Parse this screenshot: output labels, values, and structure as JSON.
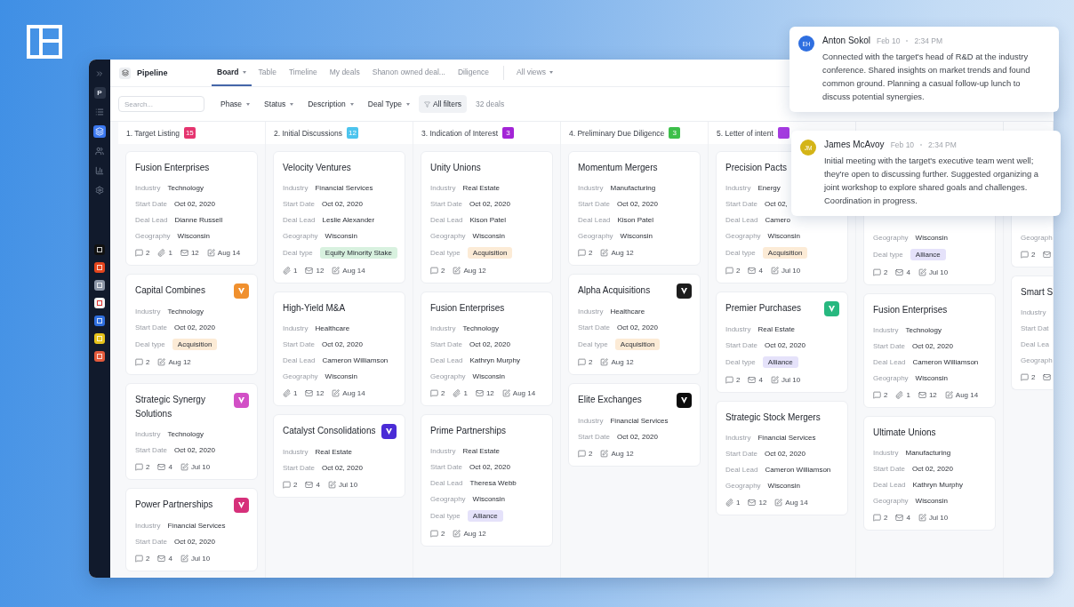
{
  "sidebar": {
    "avatar": "P",
    "nav": [
      {
        "kind": "list",
        "selected": false
      },
      {
        "kind": "layers",
        "selected": true
      },
      {
        "kind": "users",
        "selected": false
      },
      {
        "kind": "chart",
        "selected": false
      },
      {
        "kind": "settings",
        "selected": false
      }
    ],
    "apps": [
      {
        "color": "#111111"
      },
      {
        "color": "#e4451d"
      },
      {
        "color": "#8c96a8"
      },
      {
        "color": "#f4f4f4"
      },
      {
        "color": "#2f6fe0"
      },
      {
        "color": "#e6c21a"
      },
      {
        "color": "#e35a3c"
      }
    ]
  },
  "header": {
    "title": "Pipeline",
    "tabs": [
      {
        "label": "Board",
        "selected": true,
        "caret": true
      },
      {
        "label": "Table",
        "selected": false
      },
      {
        "label": "Timeline",
        "selected": false
      },
      {
        "label": "My deals",
        "selected": false
      },
      {
        "label": "Shanon owned deal...",
        "selected": false
      },
      {
        "label": "Diligence",
        "selected": false
      }
    ],
    "views": "All views"
  },
  "filters": {
    "search": {
      "placeholder": "Search..."
    },
    "dropdowns": [
      "Phase",
      "Status",
      "Description",
      "Deal Type"
    ],
    "all_filters": "All filters",
    "count": "32 deals"
  },
  "columns": [
    {
      "title": "1. Target Listing",
      "count": "15",
      "color": "#e5356f",
      "cards": [
        {
          "title": "Fusion Enterprises",
          "fields": [
            {
              "kind": "text",
              "label": "Industry",
              "value": "Technology"
            },
            {
              "kind": "text",
              "label": "Start Date",
              "value": "Oct 02, 2020"
            },
            {
              "kind": "text",
              "label": "Deal Lead",
              "value": "Dianne Russell"
            },
            {
              "kind": "text",
              "label": "Geography",
              "value": "Wisconsin"
            }
          ],
          "stats": [
            {
              "kind": "comment",
              "text": "2"
            },
            {
              "kind": "attach",
              "text": "1"
            },
            {
              "kind": "mail",
              "text": "12"
            },
            {
              "kind": "edit",
              "text": "Aug 14"
            }
          ]
        },
        {
          "title": "Capital Combines",
          "logo": {
            "color": "#f0902e"
          },
          "fields": [
            {
              "kind": "text",
              "label": "Industry",
              "value": "Technology"
            },
            {
              "kind": "text",
              "label": "Start Date",
              "value": "Oct 02, 2020"
            },
            {
              "kind": "tag",
              "label": "Deal type",
              "value": "Acquisition",
              "color": "#fcebd6"
            }
          ],
          "stats": [
            {
              "kind": "comment",
              "text": "2"
            },
            {
              "kind": "edit",
              "text": "Aug 12"
            }
          ]
        },
        {
          "title": "Strategic Synergy Solutions",
          "logo": {
            "color": "#d24fc6"
          },
          "fields": [
            {
              "kind": "text",
              "label": "Industry",
              "value": "Technology"
            },
            {
              "kind": "text",
              "label": "Start Date",
              "value": "Oct 02, 2020"
            }
          ],
          "stats": [
            {
              "kind": "comment",
              "text": "2"
            },
            {
              "kind": "mail",
              "text": "4"
            },
            {
              "kind": "edit",
              "text": "Jul 10"
            }
          ]
        },
        {
          "title": "Power Partnerships",
          "logo": {
            "color": "#d6307a"
          },
          "fields": [
            {
              "kind": "text",
              "label": "Industry",
              "value": "Financial Services"
            },
            {
              "kind": "text",
              "label": "Start Date",
              "value": "Oct 02, 2020"
            }
          ],
          "stats": [
            {
              "kind": "comment",
              "text": "2"
            },
            {
              "kind": "mail",
              "text": "4"
            },
            {
              "kind": "edit",
              "text": "Jul 10"
            }
          ]
        }
      ]
    },
    {
      "title": "2. Initial Discussions",
      "count": "12",
      "color": "#4cc4ee",
      "cards": [
        {
          "title": "Velocity Ventures",
          "fields": [
            {
              "kind": "text",
              "label": "Industry",
              "value": "Financial Services"
            },
            {
              "kind": "text",
              "label": "Start Date",
              "value": "Oct 02, 2020"
            },
            {
              "kind": "text",
              "label": "Deal Lead",
              "value": "Leslie Alexander"
            },
            {
              "kind": "text",
              "label": "Geography",
              "value": "Wisconsin"
            },
            {
              "kind": "tag",
              "label": "Deal type",
              "value": "Equity Minority Stake",
              "color": "#d8f1df"
            }
          ],
          "stats": [
            {
              "kind": "attach",
              "text": "1"
            },
            {
              "kind": "mail",
              "text": "12"
            },
            {
              "kind": "edit",
              "text": "Aug 14"
            }
          ]
        },
        {
          "title": "High-Yield M&A",
          "fields": [
            {
              "kind": "text",
              "label": "Industry",
              "value": "Healthcare"
            },
            {
              "kind": "text",
              "label": "Start Date",
              "value": "Oct 02, 2020"
            },
            {
              "kind": "text",
              "label": "Deal Lead",
              "value": "Cameron Williamson"
            },
            {
              "kind": "text",
              "label": "Geography",
              "value": "Wisconsin"
            }
          ],
          "stats": [
            {
              "kind": "attach",
              "text": "1"
            },
            {
              "kind": "mail",
              "text": "12"
            },
            {
              "kind": "edit",
              "text": "Aug 14"
            }
          ]
        },
        {
          "title": "Catalyst Consolidations",
          "logo": {
            "color": "#4a2bd6"
          },
          "fields": [
            {
              "kind": "text",
              "label": "Industry",
              "value": "Real Estate"
            },
            {
              "kind": "text",
              "label": "Start Date",
              "value": "Oct 02, 2020"
            }
          ],
          "stats": [
            {
              "kind": "comment",
              "text": "2"
            },
            {
              "kind": "mail",
              "text": "4"
            },
            {
              "kind": "edit",
              "text": "Jul 10"
            }
          ]
        }
      ]
    },
    {
      "title": "3. Indication of Interest",
      "count": "3",
      "color": "#a324d6",
      "cards": [
        {
          "title": "Unity Unions",
          "fields": [
            {
              "kind": "text",
              "label": "Industry",
              "value": "Real Estate"
            },
            {
              "kind": "text",
              "label": "Start Date",
              "value": "Oct 02, 2020"
            },
            {
              "kind": "text",
              "label": "Deal Lead",
              "value": "Kison Patel"
            },
            {
              "kind": "text",
              "label": "Geography",
              "value": "Wisconsin"
            },
            {
              "kind": "tag",
              "label": "Deal type",
              "value": "Acquisition",
              "color": "#fcebd6"
            }
          ],
          "stats": [
            {
              "kind": "comment",
              "text": "2"
            },
            {
              "kind": "edit",
              "text": "Aug 12"
            }
          ]
        },
        {
          "title": "Fusion Enterprises",
          "fields": [
            {
              "kind": "text",
              "label": "Industry",
              "value": "Technology"
            },
            {
              "kind": "text",
              "label": "Start Date",
              "value": "Oct 02, 2020"
            },
            {
              "kind": "text",
              "label": "Deal Lead",
              "value": "Kathryn Murphy"
            },
            {
              "kind": "text",
              "label": "Geography",
              "value": "Wisconsin"
            }
          ],
          "stats": [
            {
              "kind": "comment",
              "text": "2"
            },
            {
              "kind": "attach",
              "text": "1"
            },
            {
              "kind": "mail",
              "text": "12"
            },
            {
              "kind": "edit",
              "text": "Aug 14"
            }
          ]
        },
        {
          "title": "Prime Partnerships",
          "fields": [
            {
              "kind": "text",
              "label": "Industry",
              "value": "Real Estate"
            },
            {
              "kind": "text",
              "label": "Start Date",
              "value": "Oct 02, 2020"
            },
            {
              "kind": "text",
              "label": "Deal Lead",
              "value": "Theresa Webb"
            },
            {
              "kind": "text",
              "label": "Geography",
              "value": "Wisconsin"
            },
            {
              "kind": "tag",
              "label": "Deal type",
              "value": "Alliance",
              "color": "#e5e2fa"
            }
          ],
          "stats": [
            {
              "kind": "comment",
              "text": "2"
            },
            {
              "kind": "edit",
              "text": "Aug 12"
            }
          ]
        }
      ]
    },
    {
      "title": "4. Preliminary Due Diligence",
      "count": "3",
      "color": "#3dbf4a",
      "cards": [
        {
          "title": "Momentum Mergers",
          "fields": [
            {
              "kind": "text",
              "label": "Industry",
              "value": "Manufacturing"
            },
            {
              "kind": "text",
              "label": "Start Date",
              "value": "Oct 02, 2020"
            },
            {
              "kind": "text",
              "label": "Deal Lead",
              "value": "Kison Patel"
            },
            {
              "kind": "text",
              "label": "Geography",
              "value": "Wisconsin"
            }
          ],
          "stats": [
            {
              "kind": "comment",
              "text": "2"
            },
            {
              "kind": "edit",
              "text": "Aug 12"
            }
          ]
        },
        {
          "title": "Alpha Acquisitions",
          "logo": {
            "color": "#1c1c1c"
          },
          "fields": [
            {
              "kind": "text",
              "label": "Industry",
              "value": "Healthcare"
            },
            {
              "kind": "text",
              "label": "Start Date",
              "value": "Oct 02, 2020"
            },
            {
              "kind": "tag",
              "label": "Deal type",
              "value": "Acquisition",
              "color": "#fcebd6"
            }
          ],
          "stats": [
            {
              "kind": "comment",
              "text": "2"
            },
            {
              "kind": "edit",
              "text": "Aug 12"
            }
          ]
        },
        {
          "title": "Elite Exchanges",
          "logo": {
            "color": "#0c0c0c"
          },
          "fields": [
            {
              "kind": "text",
              "label": "Industry",
              "value": "Financial Services"
            },
            {
              "kind": "text",
              "label": "Start Date",
              "value": "Oct 02, 2020"
            }
          ],
          "stats": [
            {
              "kind": "comment",
              "text": "2"
            },
            {
              "kind": "edit",
              "text": "Aug 12"
            }
          ]
        }
      ]
    },
    {
      "title": "5. Letter of intent",
      "color": "#a53be0",
      "cards": [
        {
          "title": "Precision Pacts",
          "fields": [
            {
              "kind": "text",
              "label": "Industry",
              "value": "Energy"
            },
            {
              "kind": "text",
              "label": "Start Date",
              "value": "Oct 02,"
            },
            {
              "kind": "text",
              "label": "Deal Lead",
              "value": "Camero"
            },
            {
              "kind": "text",
              "label": "Geography",
              "value": "Wisconsin"
            },
            {
              "kind": "tag",
              "label": "Deal type",
              "value": "Acquisition",
              "color": "#fcebd6"
            }
          ],
          "stats": [
            {
              "kind": "comment",
              "text": "2"
            },
            {
              "kind": "mail",
              "text": "4"
            },
            {
              "kind": "edit",
              "text": "Jul 10"
            }
          ]
        },
        {
          "title": "Premier Purchases",
          "logo": {
            "color": "#27b87f"
          },
          "fields": [
            {
              "kind": "text",
              "label": "Industry",
              "value": "Real Estate"
            },
            {
              "kind": "text",
              "label": "Start Date",
              "value": "Oct 02, 2020"
            },
            {
              "kind": "tag",
              "label": "Deal type",
              "value": "Alliance",
              "color": "#e5e2fa"
            }
          ],
          "stats": [
            {
              "kind": "comment",
              "text": "2"
            },
            {
              "kind": "mail",
              "text": "4"
            },
            {
              "kind": "edit",
              "text": "Jul 10"
            }
          ]
        },
        {
          "title": "Strategic Stock Mergers",
          "fields": [
            {
              "kind": "text",
              "label": "Industry",
              "value": "Financial Services"
            },
            {
              "kind": "text",
              "label": "Start Date",
              "value": "Oct 02, 2020"
            },
            {
              "kind": "text",
              "label": "Deal Lead",
              "value": "Cameron Williamson"
            },
            {
              "kind": "text",
              "label": "Geography",
              "value": "Wisconsin"
            }
          ],
          "stats": [
            {
              "kind": "attach",
              "text": "1"
            },
            {
              "kind": "mail",
              "text": "12"
            },
            {
              "kind": "edit",
              "text": "Aug 14"
            }
          ]
        }
      ]
    },
    {
      "cards": [
        {
          "fields": [
            {
              "kind": "text",
              "label": "Geography",
              "value": "Wisconsin"
            },
            {
              "kind": "tag",
              "label": "Deal type",
              "value": "Alliance",
              "color": "#e5e2fa"
            }
          ],
          "stats": [
            {
              "kind": "comment",
              "text": "2"
            },
            {
              "kind": "mail",
              "text": "4"
            },
            {
              "kind": "edit",
              "text": "Jul 10"
            }
          ]
        },
        {
          "title": "Fusion Enterprises",
          "fields": [
            {
              "kind": "text",
              "label": "Industry",
              "value": "Technology"
            },
            {
              "kind": "text",
              "label": "Start Date",
              "value": "Oct 02, 2020"
            },
            {
              "kind": "text",
              "label": "Deal Lead",
              "value": "Cameron Williamson"
            },
            {
              "kind": "text",
              "label": "Geography",
              "value": "Wisconsin"
            }
          ],
          "stats": [
            {
              "kind": "comment",
              "text": "2"
            },
            {
              "kind": "attach",
              "text": "1"
            },
            {
              "kind": "mail",
              "text": "12"
            },
            {
              "kind": "edit",
              "text": "Aug 14"
            }
          ]
        },
        {
          "title": "Ultimate Unions",
          "fields": [
            {
              "kind": "text",
              "label": "Industry",
              "value": "Manufacturing"
            },
            {
              "kind": "text",
              "label": "Start Date",
              "value": "Oct 02, 2020"
            },
            {
              "kind": "text",
              "label": "Deal Lead",
              "value": "Kathryn Murphy"
            },
            {
              "kind": "text",
              "label": "Geography",
              "value": "Wisconsin"
            }
          ],
          "stats": [
            {
              "kind": "comment",
              "text": "2"
            },
            {
              "kind": "mail",
              "text": "4"
            },
            {
              "kind": "edit",
              "text": "Jul 10"
            }
          ]
        }
      ]
    },
    {
      "cards": [
        {
          "fields": [
            {
              "kind": "text",
              "label": "Geograph"
            }
          ],
          "stats": [
            {
              "kind": "comment",
              "text": "2"
            },
            {
              "kind": "mail"
            }
          ]
        },
        {
          "title": "Smart S",
          "fields": [
            {
              "kind": "text",
              "label": "Industry"
            },
            {
              "kind": "text",
              "label": "Start Dat"
            },
            {
              "kind": "text",
              "label": "Deal Lea"
            },
            {
              "kind": "text",
              "label": "Geograph"
            }
          ],
          "stats": [
            {
              "kind": "comment",
              "text": "2"
            },
            {
              "kind": "mail"
            }
          ]
        }
      ]
    }
  ],
  "comments": [
    {
      "initials": "EH",
      "color": "#2f6fe0",
      "author": "Anton Sokol",
      "date": "Feb 10",
      "time": "2:34 PM",
      "text": "Connected with the target's head of R&D at the industry conference. Shared insights on market trends and found common ground. Planning a casual follow-up lunch to discuss potential synergies."
    },
    {
      "initials": "JM",
      "color": "#d4b417",
      "author": "James McAvoy",
      "date": "Feb 10",
      "time": "2:34 PM",
      "text": "Initial meeting with the target's executive team went well; they're open to discussing further. Suggested organizing a joint workshop to explore shared goals and challenges. Coordination in progress."
    }
  ]
}
